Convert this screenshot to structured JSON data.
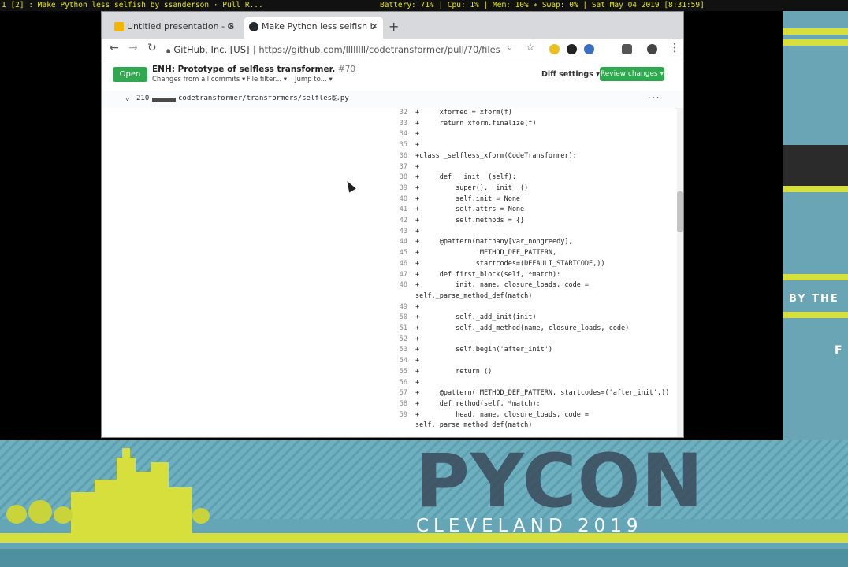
{
  "statusbar": {
    "left_text": "1 [2] : Make Python less selfish by ssanderson · Pull R...",
    "right_text": "Battery: 71% | Cpu: 1% | Mem: 10% ∗ Swap: 0% | Sat May 04 2019 [8:31:59]"
  },
  "browser": {
    "tabs": [
      {
        "label": "Untitled presentation - G",
        "icon": "slides-icon",
        "icon_color": "#f4b400"
      },
      {
        "label": "Make Python less selfish b",
        "icon": "github-icon",
        "icon_color": "#24292e"
      }
    ],
    "new_tab": "+",
    "url": {
      "identity": "GitHub, Inc. [US]",
      "separator": "|",
      "href": "https://github.com/llllllll/codetransformer/pull/70/files"
    }
  },
  "pr": {
    "state": "Open",
    "title": "ENH: Prototype of selfless transformer.",
    "number": "#70",
    "changes_from": "Changes from all commits ▾",
    "file_filter": "File filter... ▾",
    "jump_to": "Jump to... ▾",
    "diff_settings": "Diff settings ▾",
    "review_changes": "Review changes ▾"
  },
  "file": {
    "count": "210",
    "path": "codetransformer/transformers/selfless.py",
    "menu": "···"
  },
  "diff_lines": [
    {
      "n": "32",
      "code": "+     xformed = xform(f)"
    },
    {
      "n": "33",
      "code": "+     return xform.finalize(f)"
    },
    {
      "n": "34",
      "code": "+"
    },
    {
      "n": "35",
      "code": "+"
    },
    {
      "n": "36",
      "code": "+class _selfless_xform(CodeTransformer):"
    },
    {
      "n": "37",
      "code": "+"
    },
    {
      "n": "38",
      "code": "+     def __init__(self):"
    },
    {
      "n": "39",
      "code": "+         super().__init__()"
    },
    {
      "n": "40",
      "code": "+         self.init = None"
    },
    {
      "n": "41",
      "code": "+         self.attrs = None"
    },
    {
      "n": "42",
      "code": "+         self.methods = {}"
    },
    {
      "n": "43",
      "code": "+"
    },
    {
      "n": "44",
      "code": "+     @pattern(matchany[var_nongreedy],"
    },
    {
      "n": "45",
      "code": "+              'METHOD_DEF_PATTERN,"
    },
    {
      "n": "46",
      "code": "+              startcodes=(DEFAULT_STARTCODE,))"
    },
    {
      "n": "47",
      "code": "+     def first_block(self, *match):"
    },
    {
      "n": "48",
      "code": "+         init, name, closure_loads, code ="
    },
    {
      "n": "",
      "code": "self._parse_method_def(match)"
    },
    {
      "n": "49",
      "code": "+"
    },
    {
      "n": "50",
      "code": "+         self._add_init(init)"
    },
    {
      "n": "51",
      "code": "+         self._add_method(name, closure_loads, code)"
    },
    {
      "n": "52",
      "code": "+"
    },
    {
      "n": "53",
      "code": "+         self.begin('after_init')"
    },
    {
      "n": "54",
      "code": "+"
    },
    {
      "n": "55",
      "code": "+         return ()"
    },
    {
      "n": "56",
      "code": "+"
    },
    {
      "n": "57",
      "code": "+     @pattern('METHOD_DEF_PATTERN, startcodes=('after_init',))"
    },
    {
      "n": "58",
      "code": "+     def method(self, *match):"
    },
    {
      "n": "59",
      "code": "+         head, name, closure_loads, code ="
    },
    {
      "n": "",
      "code": "self._parse_method_def(match)"
    }
  ],
  "slide": {
    "word": "PYCON",
    "subtitle": "CLEVELAND 2019",
    "right_text_1": "BY THE",
    "right_text_2": "F",
    "accent": "#d7df3c",
    "bg": "#64a6b6"
  }
}
